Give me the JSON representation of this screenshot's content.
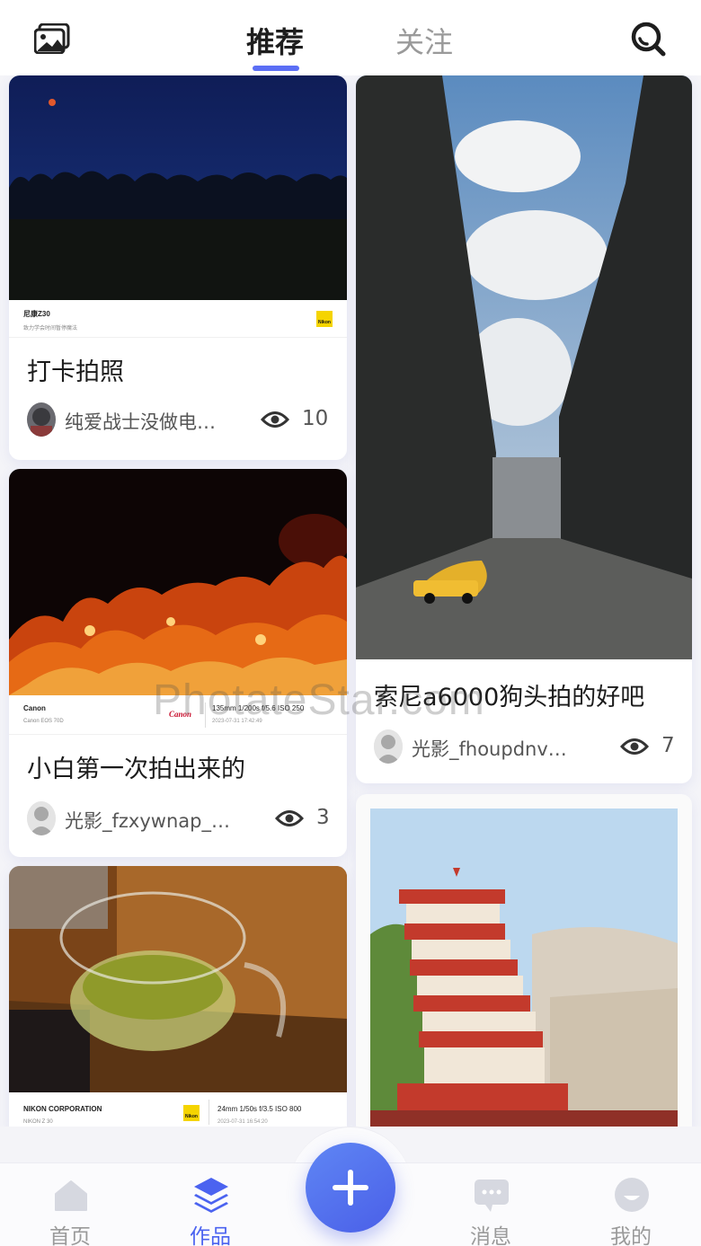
{
  "header": {
    "tab_recommend": "推荐",
    "tab_follow": "关注",
    "gallery_icon": "gallery-icon",
    "search_icon": "search-icon"
  },
  "cards": [
    {
      "title": "打卡拍照",
      "author": "纯爱战士没做电…",
      "views": "10",
      "exif": {
        "brand": "尼康Z30",
        "model": "致力学会时间暂停魔法"
      }
    },
    {
      "title": "小白第一次拍出来的",
      "author": "光影_fzxywnap_…",
      "views": "3",
      "exif": {
        "brand": "Canon",
        "model": "Canon EOS 70D",
        "lens": "135mm  1/200s  f/5.6 ISO 250",
        "time": "2023-07-31 17:42:49",
        "logo": "Canon"
      }
    },
    {
      "title": "",
      "exif": {
        "brand": "NIKON CORPORATION",
        "model": "NIKON Z 30",
        "lens": "24mm  1/50s  f/3.5 ISO 800",
        "time": "2023-07-31 16:54:20"
      }
    },
    {
      "title": "索尼a6000狗头拍的好吧",
      "author": "光影_fhoupdnv…",
      "views": "7"
    }
  ],
  "nikon_label": "Nikon",
  "watermark": "PhotateStar.com",
  "bottom_nav": {
    "home": "首页",
    "works": "作品",
    "messages": "消息",
    "mine": "我的"
  },
  "colors": {
    "accent": "#4b63f0",
    "inactive": "#9a9a9a"
  }
}
